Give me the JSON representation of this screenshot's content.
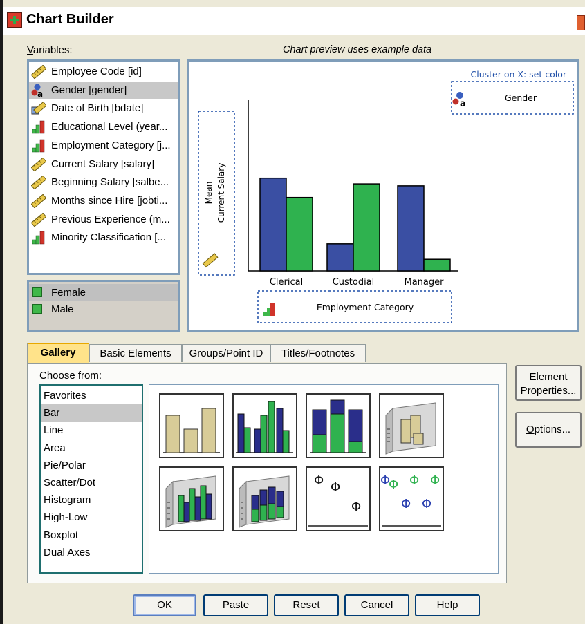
{
  "window": {
    "title": "Chart Builder"
  },
  "variables": {
    "label_underline": "V",
    "label_rest": "ariables:",
    "items": [
      {
        "label": "Employee Code [id]",
        "icon": "scale-ruler-icon"
      },
      {
        "label": "Gender [gender]",
        "icon": "nominal-ab-icon"
      },
      {
        "label": "Date of Birth [bdate]",
        "icon": "date-ruler-icon"
      },
      {
        "label": "Educational Level (year...",
        "icon": "ordinal-bars-icon"
      },
      {
        "label": "Employment Category [j...",
        "icon": "ordinal-bars-icon"
      },
      {
        "label": "Current Salary [salary]",
        "icon": "scale-ruler-icon"
      },
      {
        "label": "Beginning Salary [salbe...",
        "icon": "scale-ruler-icon"
      },
      {
        "label": "Months since Hire [jobti...",
        "icon": "scale-ruler-icon"
      },
      {
        "label": "Previous Experience (m...",
        "icon": "scale-ruler-icon"
      },
      {
        "label": "Minority Classification [...",
        "icon": "ordinal-bars-icon"
      }
    ],
    "selected_index": 1
  },
  "categories": {
    "items": [
      {
        "label": "Female"
      },
      {
        "label": "Male"
      }
    ],
    "selected_index": 0
  },
  "preview": {
    "caption": "Chart preview uses example data",
    "cluster_caption": "Cluster on X: set color",
    "cluster_variable": "Gender",
    "y_drop_line1": "Mean",
    "y_drop_line2": "Current Salary",
    "x_drop": "Employment Category"
  },
  "chart_data": {
    "type": "bar",
    "categories": [
      "Clerical",
      "Custodial",
      "Manager"
    ],
    "series": [
      {
        "values": [
          4.8,
          1.4,
          4.4
        ],
        "color": "#3a4fa3"
      },
      {
        "values": [
          3.8,
          4.5,
          0.6
        ],
        "color": "#2fb24f"
      }
    ],
    "ylim": [
      0,
      9.4
    ],
    "grid": false
  },
  "tabs": [
    "Gallery",
    "Basic Elements",
    "Groups/Point ID",
    "Titles/Footnotes"
  ],
  "active_tab": 0,
  "gallery": {
    "choose_label": "Choose from:",
    "chart_types": [
      "Favorites",
      "Bar",
      "Line",
      "Area",
      "Pie/Polar",
      "Scatter/Dot",
      "Histogram",
      "High-Low",
      "Boxplot",
      "Dual Axes"
    ],
    "selected_type": 1,
    "thumbnails": [
      "simple-bar-icon",
      "clustered-bar-icon",
      "stacked-bar-icon",
      "3d-bar-icon",
      "3d-clustered-bar-icon",
      "3d-stacked-bar-icon",
      "error-bar-icon",
      "clustered-error-bar-icon"
    ]
  },
  "side_buttons": {
    "element_line1_pre": "Elemen",
    "element_line1_u": "t",
    "element_line2": "Properties...",
    "options_u": "O",
    "options_rest": "ptions..."
  },
  "buttons": {
    "ok": "OK",
    "paste_u": "P",
    "paste_rest": "aste",
    "reset_u": "R",
    "reset_rest": "eset",
    "cancel": "Cancel",
    "help": "Help"
  },
  "colors": {
    "blue_series": "#3a4fa3",
    "green_series": "#2fb24f",
    "tan_bar": "#d8cc98",
    "active_tab": "#ffe38a",
    "selection": "#c8c8c8"
  }
}
